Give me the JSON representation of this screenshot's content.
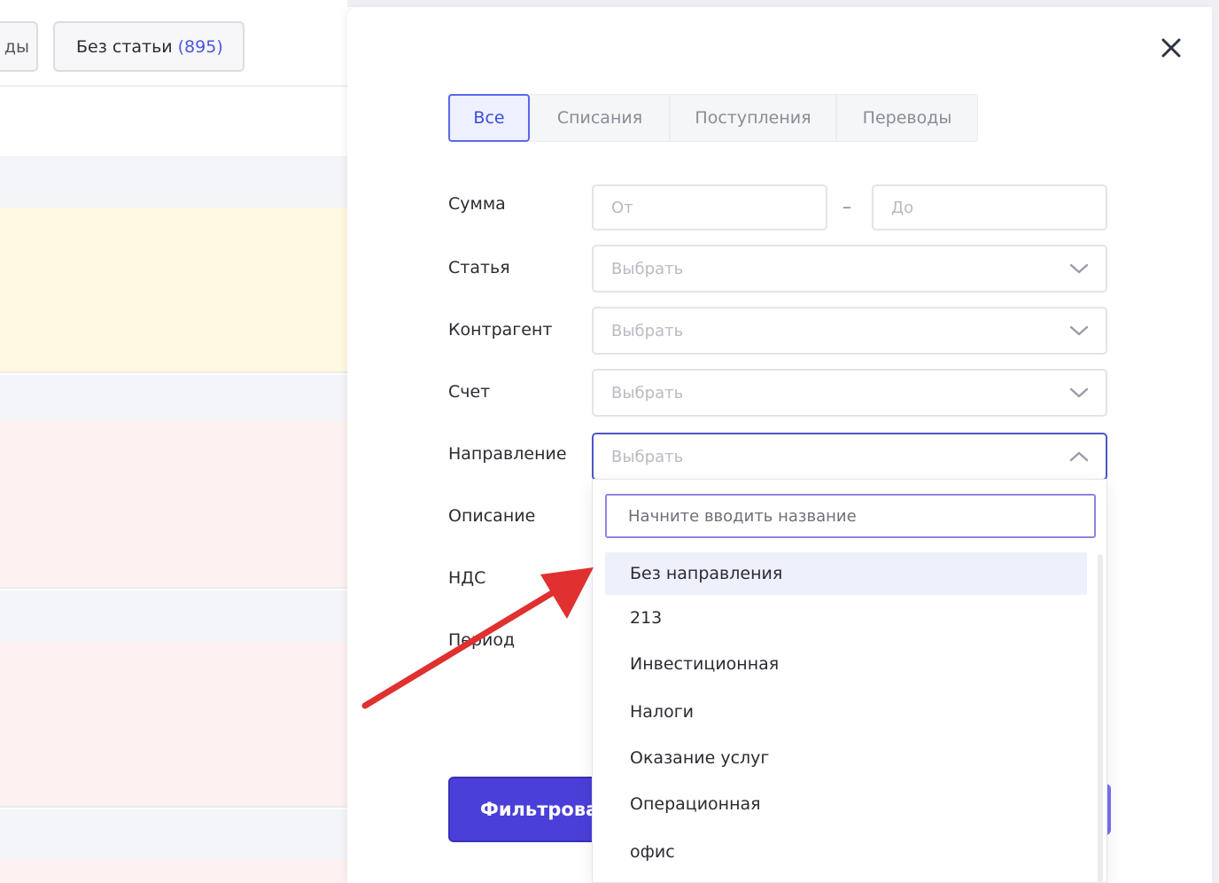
{
  "background": {
    "chip_left_text": "ды",
    "chip_main_text": "Без статьи",
    "chip_main_count": "(895)"
  },
  "panel": {
    "close_icon": "close-icon",
    "tabs": [
      {
        "label": "Все",
        "active": true
      },
      {
        "label": "Списания",
        "active": false
      },
      {
        "label": "Поступления",
        "active": false
      },
      {
        "label": "Переводы",
        "active": false
      }
    ],
    "fields": {
      "sum": {
        "label": "Сумма",
        "from_placeholder": "От",
        "to_placeholder": "До",
        "separator": "–"
      },
      "article": {
        "label": "Статья",
        "placeholder": "Выбрать"
      },
      "counterparty": {
        "label": "Контрагент",
        "placeholder": "Выбрать"
      },
      "account": {
        "label": "Счет",
        "placeholder": "Выбрать"
      },
      "direction": {
        "label": "Направление",
        "placeholder": "Выбрать"
      },
      "description": {
        "label": "Описание"
      },
      "vat": {
        "label": "НДС"
      },
      "period": {
        "label": "Период"
      }
    },
    "filter_button": "Фильтровать"
  },
  "dropdown": {
    "search_placeholder": "Начните вводить название",
    "options": [
      "Без направления",
      "213",
      "Инвестиционная",
      "Налоги",
      "Оказание услуг",
      "Операционная",
      "офис"
    ],
    "highlighted_index": 0
  },
  "colors": {
    "accent": "#4a3fd8",
    "active_tab": "#3b4bdc",
    "annotation_arrow": "#e03030"
  }
}
